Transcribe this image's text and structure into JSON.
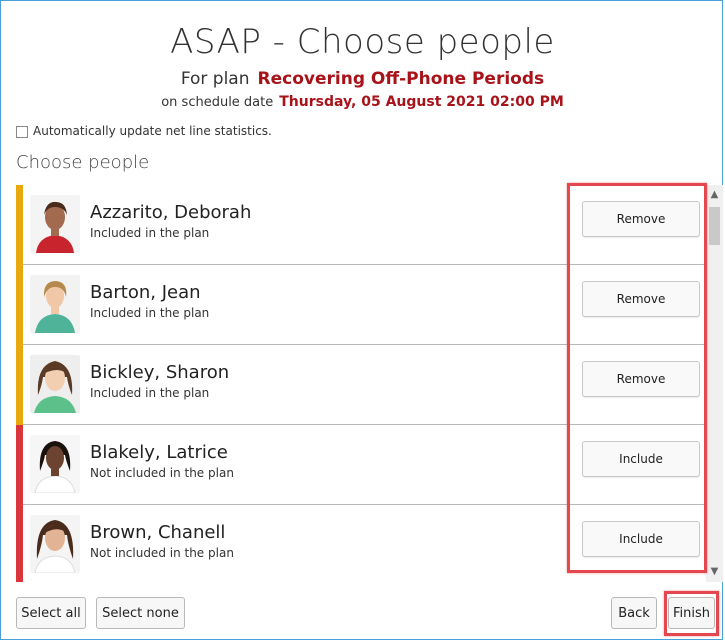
{
  "header": {
    "title": "ASAP - Choose people",
    "for_plan_label": "For plan",
    "plan_name": "Recovering Off-Phone Periods",
    "schedule_label": "on schedule date",
    "schedule_date": "Thursday, 05 August 2021 02:00 PM"
  },
  "options": {
    "auto_update_label": "Automatically update net line statistics.",
    "auto_update_checked": false
  },
  "section_title": "Choose people",
  "people": [
    {
      "name": "Azzarito, Deborah",
      "status": "Included in the plan",
      "action": "Remove",
      "included": true
    },
    {
      "name": "Barton, Jean",
      "status": "Included in the plan",
      "action": "Remove",
      "included": true
    },
    {
      "name": "Bickley, Sharon",
      "status": "Included in the plan",
      "action": "Remove",
      "included": true
    },
    {
      "name": "Blakely, Latrice",
      "status": "Not included in the plan",
      "action": "Include",
      "included": false
    },
    {
      "name": "Brown, Chanell",
      "status": "Not included in the plan",
      "action": "Include",
      "included": false
    }
  ],
  "colors": {
    "included_bar": "#e8a90e",
    "not_included_bar": "#d9353b",
    "accent_text": "#a8131a",
    "highlight": "#e4474d"
  },
  "footer": {
    "select_all": "Select all",
    "select_none": "Select none",
    "back": "Back",
    "finish": "Finish"
  }
}
